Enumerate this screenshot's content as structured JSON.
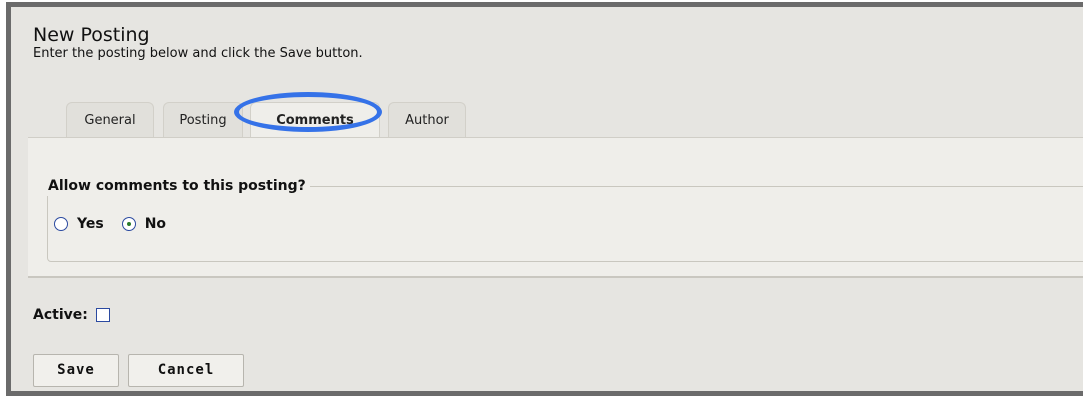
{
  "page": {
    "title": "New Posting",
    "subtitle": "Enter the posting below and click the Save button."
  },
  "tabs": [
    {
      "label": "General",
      "active": false
    },
    {
      "label": "Posting",
      "active": false
    },
    {
      "label": "Comments",
      "active": true
    },
    {
      "label": "Author",
      "active": false
    }
  ],
  "comments": {
    "legend": "Allow comments to this posting?",
    "options": [
      {
        "label": "Yes",
        "checked": false
      },
      {
        "label": "No",
        "checked": true
      }
    ]
  },
  "active": {
    "label": "Active:",
    "checked": false
  },
  "buttons": {
    "save": "Save",
    "cancel": "Cancel"
  },
  "colors": {
    "highlight": "#3572e8",
    "frame": "#6b6b6b",
    "background": "#e6e5e1"
  }
}
